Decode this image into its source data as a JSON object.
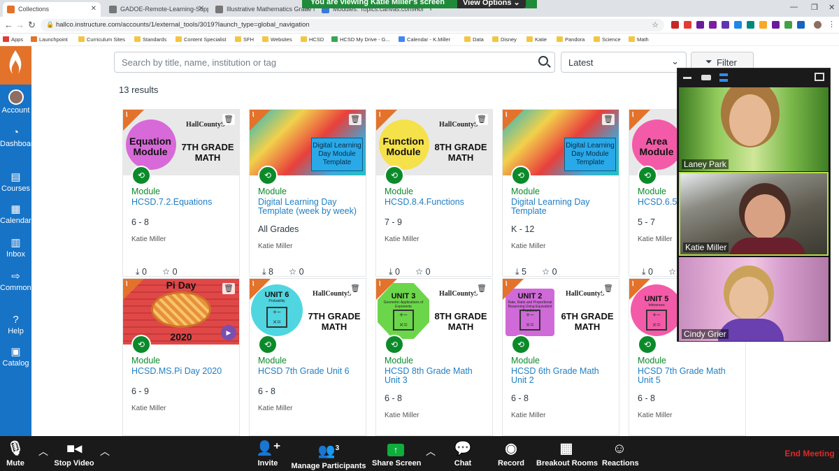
{
  "tabs": [
    {
      "label": "Collections",
      "active": true
    },
    {
      "label": "GADOE-Remote-Learning-Suppli"
    },
    {
      "label": "Illustrative Mathematics Grade 8"
    },
    {
      "label": "Modules: Topics.canvas.commons"
    }
  ],
  "zoom_banner": {
    "viewing": "You are viewing Katie Miller's screen",
    "view_options": "View Options ⌄"
  },
  "address": {
    "url": "hallco.instructure.com/accounts/1/external_tools/3019?launch_type=global_navigation"
  },
  "bookmarks": [
    "Apps",
    "Launchpoint",
    "Curriculum Sites",
    "Standards",
    "Content Specialist",
    "SFH",
    "Websites",
    "HCSD",
    "HCSD My Drive - G...",
    "Calendar - K.Miller",
    "Data",
    "Disney",
    "Katie",
    "Pandora",
    "Science",
    "Math"
  ],
  "sidebar": [
    {
      "label": "Account",
      "icon": "avatar"
    },
    {
      "label": "Dashboard",
      "icon": "dashboard-icon"
    },
    {
      "label": "Courses",
      "icon": "courses-icon"
    },
    {
      "label": "Calendar",
      "icon": "calendar-icon"
    },
    {
      "label": "Inbox",
      "icon": "inbox-icon"
    },
    {
      "label": "Commons",
      "icon": "commons-icon"
    },
    {
      "label": "Help",
      "icon": "help-icon"
    },
    {
      "label": "Catalog",
      "icon": "catalog-icon"
    }
  ],
  "search": {
    "placeholder": "Search by title, name, institution or tag"
  },
  "sort": {
    "value": "Latest"
  },
  "filter": {
    "label": "Filter"
  },
  "results": "13 results",
  "cards": [
    {
      "type": "Module",
      "title": "HCSD.7.2.Equations",
      "grade": "6 - 8",
      "author": "Katie Miller",
      "downloads": "0",
      "favorites": "0",
      "thumb": {
        "big": "Equation Module",
        "right": "7TH GRADE MATH",
        "circle": "#d869d8",
        "bg": "#e8e8e8",
        "hc": "HallCountyS"
      }
    },
    {
      "type": "Module",
      "title": "Digital Learning Day Template (week by week)",
      "grade": "All Grades",
      "author": "Katie Miller",
      "downloads": "8",
      "favorites": "0",
      "thumb": {
        "box": "Digital Learning Day Module Template"
      }
    },
    {
      "type": "Module",
      "title": "HCSD.8.4.Functions",
      "grade": "7 - 9",
      "author": "Katie Miller",
      "downloads": "0",
      "favorites": "0",
      "thumb": {
        "big": "Function Module",
        "right": "8TH GRADE MATH",
        "circle": "#f5e14a",
        "bg": "#e8e8e8",
        "hc": "HallCountyS"
      }
    },
    {
      "type": "Module",
      "title": "Digital Learning Day Template",
      "grade": "K - 12",
      "author": "Katie Miller",
      "downloads": "5",
      "favorites": "0",
      "thumb": {
        "box": "Digital Learning Day Module Template"
      }
    },
    {
      "type": "Module",
      "title": "HCSD.6.5",
      "grade": "5 - 7",
      "author": "Katie Miller",
      "downloads": "0",
      "favorites": "0",
      "thumb": {
        "big": "Area Module",
        "circle": "#f35ba8",
        "bg": "#e8e8e8"
      }
    },
    {
      "type": "Module",
      "title": "HCSD.MS.Pi Day 2020",
      "grade": "6 - 9",
      "author": "Katie Miller",
      "thumb": {
        "top": "Pi Day",
        "bottom": "2020"
      }
    },
    {
      "type": "Module",
      "title": "HCSD 7th Grade Unit 6",
      "grade": "6 - 8",
      "author": "Katie Miller",
      "thumb": {
        "unit": "UNIT 6",
        "sub": "Probability",
        "right": "7TH GRADE MATH",
        "circle": "#4fd6e0",
        "hc": "HallCountyS"
      }
    },
    {
      "type": "Module",
      "title": "HCSD 8th Grade Math Unit 3",
      "grade": "6 - 8",
      "author": "Katie Miller",
      "thumb": {
        "unit": "UNIT 3",
        "sub": "Geometric Applications of Exponents",
        "right": "8TH GRADE MATH",
        "circle": "#6cd64a",
        "hc": "HallCountyS"
      }
    },
    {
      "type": "Module",
      "title": "HCSD 6th Grade Math Unit 2",
      "grade": "6 - 8",
      "author": "Katie Miller",
      "thumb": {
        "unit": "UNIT 2",
        "sub": "Rate, Ratio and Proportional Reasoning Using Equivalent Fractions",
        "right": "6TH GRADE MATH",
        "circle": "#d06ad8",
        "hc": "HallCountyS"
      }
    },
    {
      "type": "Module",
      "title": "HCSD 7th Grade Math Unit 5",
      "grade": "6 - 8",
      "author": "Katie Miller",
      "thumb": {
        "unit": "UNIT 5",
        "sub": "Inferences",
        "circle": "#f35ba8"
      }
    }
  ],
  "participants": [
    {
      "name": "Laney Park",
      "bg": "#5f9a3a"
    },
    {
      "name": "Katie Miller",
      "bg": "#6b6458"
    },
    {
      "name": "Cindy Grier",
      "bg": "#8a7aa0"
    }
  ],
  "zoom_bar": {
    "mute": "Mute",
    "stop_video": "Stop Video",
    "invite": "Invite",
    "manage": "Manage Participants",
    "participant_count": "3",
    "share": "Share Screen",
    "chat": "Chat",
    "record": "Record",
    "breakout": "Breakout Rooms",
    "reactions": "Reactions",
    "end": "End Meeting"
  }
}
